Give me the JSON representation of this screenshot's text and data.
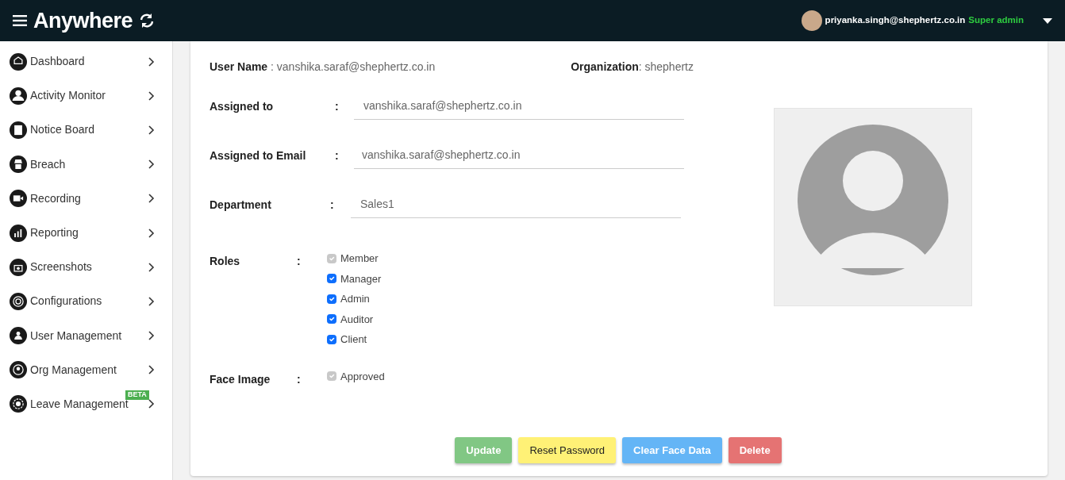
{
  "header": {
    "brand": "Anywhere",
    "user_email": "priyanka.singh@shephertz.co.in",
    "user_role": "Super admin"
  },
  "sidebar": {
    "items": [
      {
        "label": "Dashboard"
      },
      {
        "label": "Activity Monitor"
      },
      {
        "label": "Notice Board"
      },
      {
        "label": "Breach"
      },
      {
        "label": "Recording"
      },
      {
        "label": "Reporting"
      },
      {
        "label": "Screenshots"
      },
      {
        "label": "Configurations"
      },
      {
        "label": "User Management"
      },
      {
        "label": "Org Management"
      },
      {
        "label": "Leave Management",
        "badge": "BETA"
      }
    ]
  },
  "info": [
    {
      "label": "User Name",
      "separator": " : ",
      "value": "vanshika.saraf@shephertz.co.in"
    },
    {
      "label": "Organization",
      "separator": ": ",
      "value": "shephertz"
    }
  ],
  "fields": [
    {
      "label": "Assigned to",
      "separator": ":",
      "kind": "select",
      "value": "vanshika.saraf@shephertz.co.in"
    },
    {
      "label": "Assigned to Email",
      "separator": ":",
      "kind": "input",
      "value": "vanshika.saraf@shephertz.co.in"
    },
    {
      "label": "Department",
      "separator": ":",
      "kind": "select",
      "value": "Sales1"
    }
  ],
  "roles": {
    "label": "Roles",
    "separator": ":",
    "items": [
      {
        "label": "Member",
        "checked": true,
        "disabled": true
      },
      {
        "label": "Manager",
        "checked": true,
        "disabled": false
      },
      {
        "label": "Admin",
        "checked": true,
        "disabled": false
      },
      {
        "label": "Auditor",
        "checked": true,
        "disabled": false
      },
      {
        "label": "Client",
        "checked": true,
        "disabled": false
      }
    ]
  },
  "face_image": {
    "label": "Face Image",
    "separator": ":",
    "items": [
      {
        "label": "Approved",
        "checked": true,
        "disabled": true
      }
    ]
  },
  "buttons": [
    {
      "label": "Update",
      "kind": "success"
    },
    {
      "label": "Reset Password",
      "kind": "warning"
    },
    {
      "label": "Clear Face Data",
      "kind": "info"
    },
    {
      "label": "Delete",
      "kind": "danger"
    }
  ]
}
